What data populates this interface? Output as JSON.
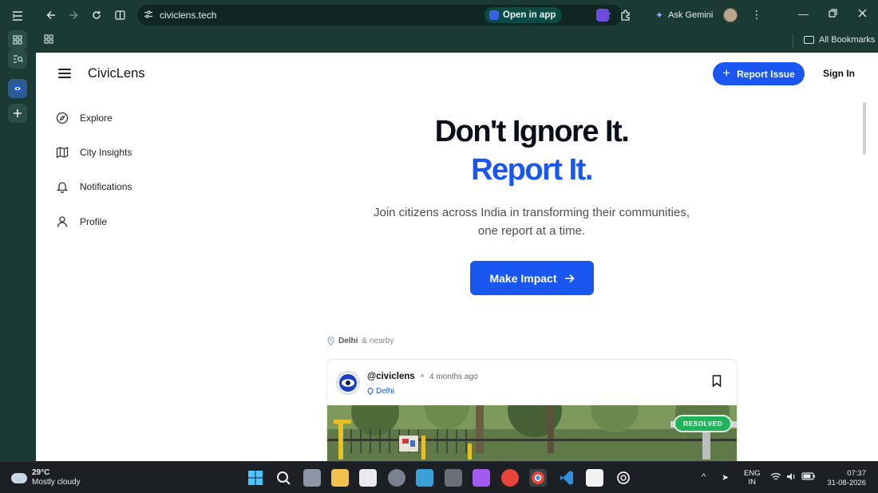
{
  "browser": {
    "url": "civiclens.tech",
    "open_in_app_label": "Open in app",
    "ask_gemini_label": "Ask Gemini",
    "all_bookmarks_label": "All Bookmarks"
  },
  "header": {
    "brand": "CivicLens",
    "report_issue_label": "Report Issue",
    "sign_in_label": "Sign In"
  },
  "sidebar": {
    "items": [
      {
        "label": "Explore",
        "icon": "compass-icon"
      },
      {
        "label": "City Insights",
        "icon": "map-icon"
      },
      {
        "label": "Notifications",
        "icon": "bell-icon"
      },
      {
        "label": "Profile",
        "icon": "user-icon"
      }
    ]
  },
  "hero": {
    "headline_line1": "Don't Ignore It.",
    "headline_line2": "Report It.",
    "subtext_line1": "Join citizens across India in transforming their communities,",
    "subtext_line2": "one report at a time.",
    "cta_label": "Make Impact"
  },
  "feed": {
    "location_city": "Delhi",
    "location_suffix": "& nearby",
    "post": {
      "handle": "@civiclens",
      "time_ago": "4 months ago",
      "place": "Delhi",
      "status": "RESOLVED"
    }
  },
  "taskbar": {
    "temperature": "29°C",
    "weather": "Mostly cloudy",
    "lang_top": "ENG",
    "lang_bottom": "IN",
    "time": "07:37",
    "date": "31-08-2026"
  },
  "colors": {
    "brand_blue": "#1a56f0",
    "resolved_green": "#22b45a",
    "browser_frame": "#1b3a34"
  }
}
